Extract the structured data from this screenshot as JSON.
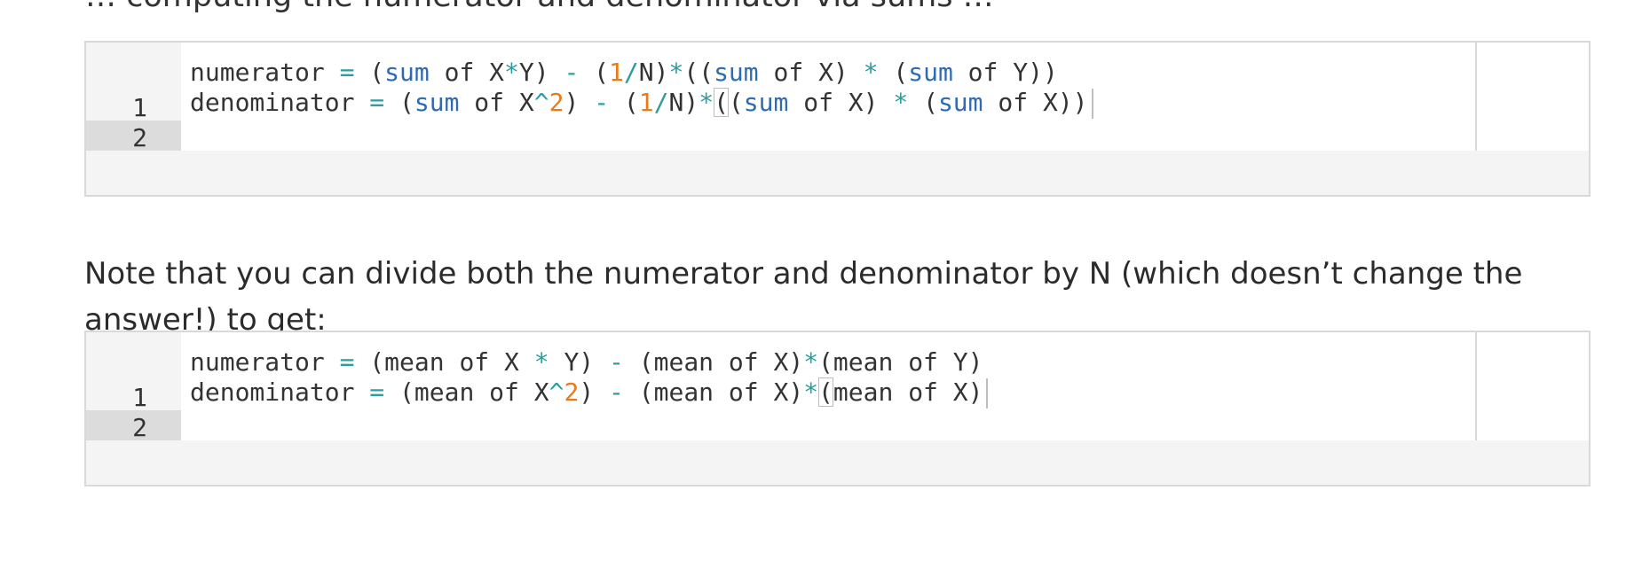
{
  "top_clipped_text": "…  computing the  numerator  and  denominator  via  sums …",
  "editor1": {
    "lines": [
      {
        "num": "1",
        "tokens": [
          {
            "t": "numerator ",
            "c": "tx"
          },
          {
            "t": "=",
            "c": "op"
          },
          {
            "t": " (",
            "c": "tx"
          },
          {
            "t": "sum",
            "c": "kw"
          },
          {
            "t": " of X",
            "c": "tx"
          },
          {
            "t": "*",
            "c": "op"
          },
          {
            "t": "Y) ",
            "c": "tx"
          },
          {
            "t": "-",
            "c": "op"
          },
          {
            "t": " (",
            "c": "tx"
          },
          {
            "t": "1",
            "c": "nm"
          },
          {
            "t": "/",
            "c": "op"
          },
          {
            "t": "N)",
            "c": "tx"
          },
          {
            "t": "*",
            "c": "op"
          },
          {
            "t": "((",
            "c": "tx"
          },
          {
            "t": "sum",
            "c": "kw"
          },
          {
            "t": " of X) ",
            "c": "tx"
          },
          {
            "t": "*",
            "c": "op"
          },
          {
            "t": " (",
            "c": "tx"
          },
          {
            "t": "sum",
            "c": "kw"
          },
          {
            "t": " of Y))",
            "c": "tx"
          }
        ]
      },
      {
        "num": "2",
        "tokens": [
          {
            "t": "denominator ",
            "c": "tx"
          },
          {
            "t": "=",
            "c": "op"
          },
          {
            "t": " (",
            "c": "tx"
          },
          {
            "t": "sum",
            "c": "kw"
          },
          {
            "t": " of X",
            "c": "tx"
          },
          {
            "t": "^",
            "c": "op"
          },
          {
            "t": "2",
            "c": "nm"
          },
          {
            "t": ") ",
            "c": "tx"
          },
          {
            "t": "-",
            "c": "op"
          },
          {
            "t": " (",
            "c": "tx"
          },
          {
            "t": "1",
            "c": "nm"
          },
          {
            "t": "/",
            "c": "op"
          },
          {
            "t": "N)",
            "c": "tx"
          },
          {
            "t": "*",
            "c": "op"
          },
          {
            "t": "(",
            "c": "bx"
          },
          {
            "t": "(",
            "c": "tx"
          },
          {
            "t": "sum",
            "c": "kw"
          },
          {
            "t": " of X) ",
            "c": "tx"
          },
          {
            "t": "*",
            "c": "op"
          },
          {
            "t": " (",
            "c": "tx"
          },
          {
            "t": "sum",
            "c": "kw"
          },
          {
            "t": " of X))",
            "c": "tx"
          }
        ]
      }
    ]
  },
  "paragraph": "Note that you can divide both the numerator and denominator by N (which doesn’t change the answer!) to get:",
  "editor2": {
    "lines": [
      {
        "num": "1",
        "tokens": [
          {
            "t": "numerator ",
            "c": "tx"
          },
          {
            "t": "=",
            "c": "op"
          },
          {
            "t": " (mean of X ",
            "c": "tx"
          },
          {
            "t": "*",
            "c": "op"
          },
          {
            "t": " Y) ",
            "c": "tx"
          },
          {
            "t": "-",
            "c": "op"
          },
          {
            "t": " (mean of X)",
            "c": "tx"
          },
          {
            "t": "*",
            "c": "op"
          },
          {
            "t": "(mean of Y)",
            "c": "tx"
          }
        ]
      },
      {
        "num": "2",
        "tokens": [
          {
            "t": "denominator ",
            "c": "tx"
          },
          {
            "t": "=",
            "c": "op"
          },
          {
            "t": " (mean of X",
            "c": "tx"
          },
          {
            "t": "^",
            "c": "op"
          },
          {
            "t": "2",
            "c": "nm"
          },
          {
            "t": ") ",
            "c": "tx"
          },
          {
            "t": "-",
            "c": "op"
          },
          {
            "t": " (mean of X)",
            "c": "tx"
          },
          {
            "t": "*",
            "c": "op"
          },
          {
            "t": "(",
            "c": "bx"
          },
          {
            "t": "mean of X)",
            "c": "tx"
          }
        ]
      }
    ]
  }
}
